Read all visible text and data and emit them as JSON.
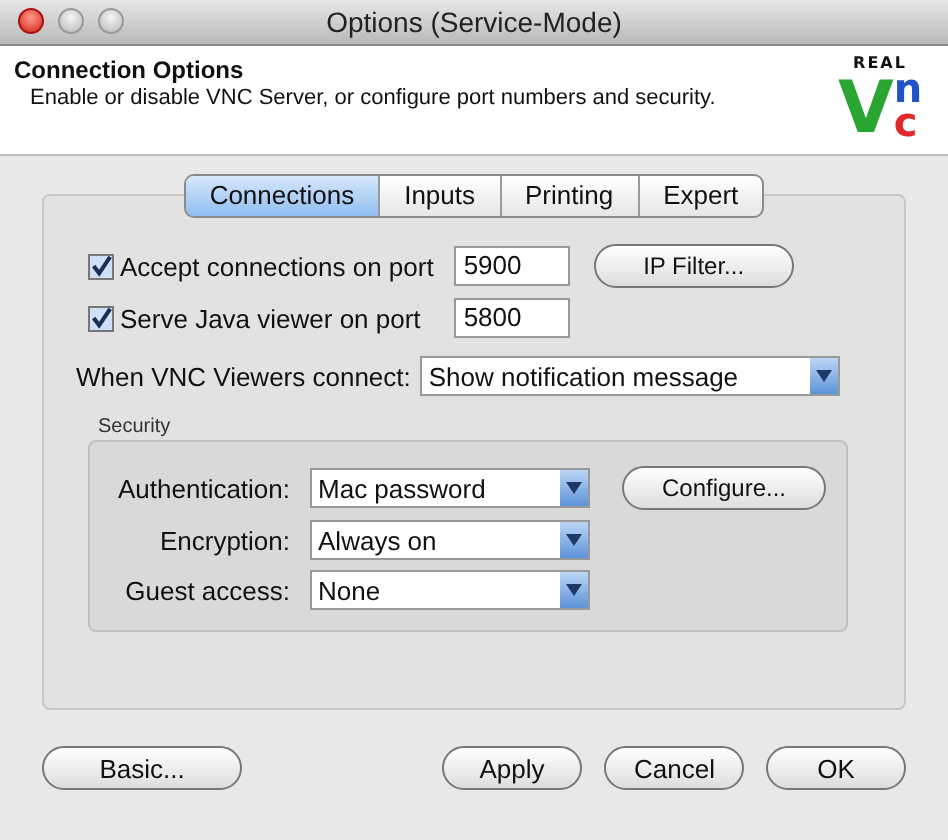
{
  "window": {
    "title": "Options (Service-Mode)"
  },
  "header": {
    "title": "Connection Options",
    "description": "Enable or disable VNC Server, or configure port numbers and security.",
    "logo": {
      "top": "REAL",
      "letters": [
        "V",
        "n",
        "c"
      ]
    }
  },
  "tabs": [
    {
      "label": "Connections",
      "selected": true
    },
    {
      "label": "Inputs",
      "selected": false
    },
    {
      "label": "Printing",
      "selected": false
    },
    {
      "label": "Expert",
      "selected": false
    }
  ],
  "ports": [
    {
      "label": "Accept connections on port",
      "checked": true,
      "value": "5900",
      "button": "IP Filter..."
    },
    {
      "label": "Serve Java viewer on port",
      "checked": true,
      "value": "5800"
    }
  ],
  "on_connect": {
    "label": "When VNC Viewers connect:",
    "value": "Show notification message"
  },
  "security": {
    "title": "Security",
    "rows": [
      {
        "label": "Authentication:",
        "value": "Mac password",
        "button": "Configure..."
      },
      {
        "label": "Encryption:",
        "value": "Always on"
      },
      {
        "label": "Guest access:",
        "value": "None"
      }
    ]
  },
  "buttons": {
    "left": [
      "Basic..."
    ],
    "right": [
      "Apply",
      "Cancel",
      "OK"
    ]
  }
}
